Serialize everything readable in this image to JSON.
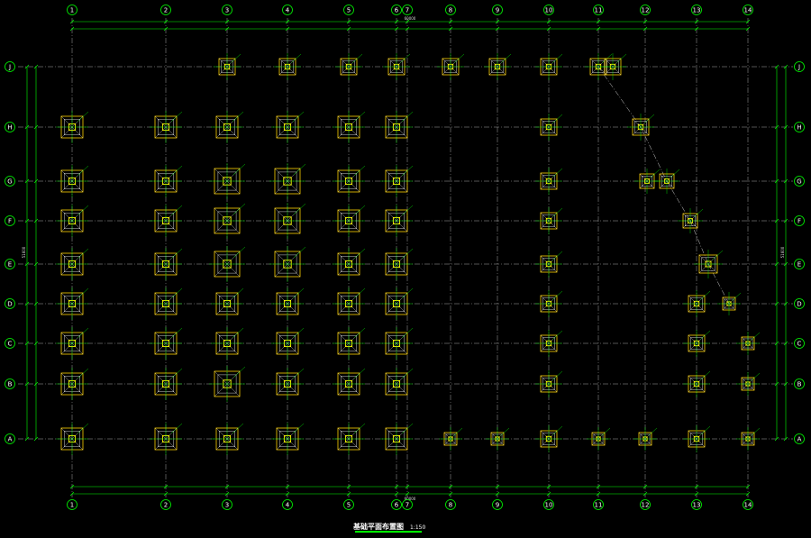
{
  "drawing": {
    "title": "基础平面布置图",
    "scale": "1:150",
    "colors": {
      "background": "#000000",
      "gridline": "#cfcfcf",
      "dimension": "#00ff00",
      "bubble": "#00ff00",
      "footing_outer": "#ffd400",
      "footing_inner": "#ffffff",
      "column": "#ffff00",
      "title_underline": "#00ff00"
    }
  },
  "axes": {
    "columns": [
      "1",
      "2",
      "3",
      "4",
      "5",
      "6",
      "7",
      "8",
      "9",
      "10",
      "11",
      "12",
      "13",
      "14"
    ],
    "rows": [
      "J",
      "H",
      "G",
      "F",
      "E",
      "D",
      "C",
      "B",
      "A"
    ]
  },
  "dimensions": {
    "top_overall": "60000",
    "bottom_overall": "60000",
    "left_overall": "51600",
    "right_overall": "51600"
  }
}
